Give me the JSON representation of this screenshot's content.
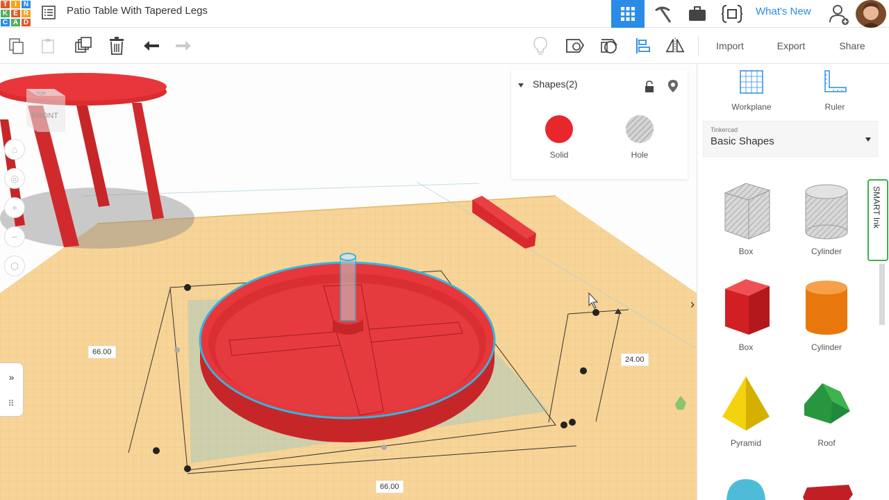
{
  "app": {
    "logo_letters": [
      "T",
      "I",
      "N",
      "K",
      "E",
      "R",
      "C",
      "A",
      "D"
    ],
    "logo_colors": [
      "#e3562a",
      "#f4a41c",
      "#2b8ce8",
      "#4fae5e",
      "#e3562a",
      "#f4a41c",
      "#2b8ce8",
      "#4fae5e",
      "#e3562a"
    ],
    "design_title": "Patio Table With Tapered Legs",
    "whats_new": "What's New",
    "accent": "#2b8ce8"
  },
  "topbar": {
    "icons": [
      "grid-view-icon",
      "pickaxe-icon",
      "briefcase-icon",
      "code-blocks-icon",
      "add-user-icon"
    ]
  },
  "toolbar": {
    "import_label": "Import",
    "export_label": "Export",
    "share_label": "Share",
    "icons": [
      "copy-icon",
      "paste-icon",
      "duplicate-icon",
      "delete-icon",
      "undo-icon",
      "redo-icon",
      "lightbulb-icon",
      "group-icon",
      "ungroup-icon",
      "align-icon",
      "mirror-icon"
    ]
  },
  "viewcube": {
    "top": "TOP",
    "front": "FRONT"
  },
  "dimensions": {
    "width": "66.00",
    "depth": "66.00",
    "height": "24.00"
  },
  "inspector": {
    "title": "Shapes(2)",
    "solid_label": "Solid",
    "hole_label": "Hole",
    "solid_color": "#e8262b"
  },
  "right_panel": {
    "workplane_label": "Workplane",
    "ruler_label": "Ruler",
    "library_category": "Tinkercad",
    "library_name": "Basic Shapes",
    "smart_ink": "SMART Ink",
    "shapes": [
      {
        "label": "Box",
        "icon": "box-hole-icon"
      },
      {
        "label": "Cylinder",
        "icon": "cylinder-hole-icon"
      },
      {
        "label": "Box",
        "icon": "box-icon"
      },
      {
        "label": "Cylinder",
        "icon": "cylinder-icon"
      },
      {
        "label": "Pyramid",
        "icon": "pyramid-icon"
      },
      {
        "label": "Roof",
        "icon": "roof-icon"
      }
    ]
  }
}
